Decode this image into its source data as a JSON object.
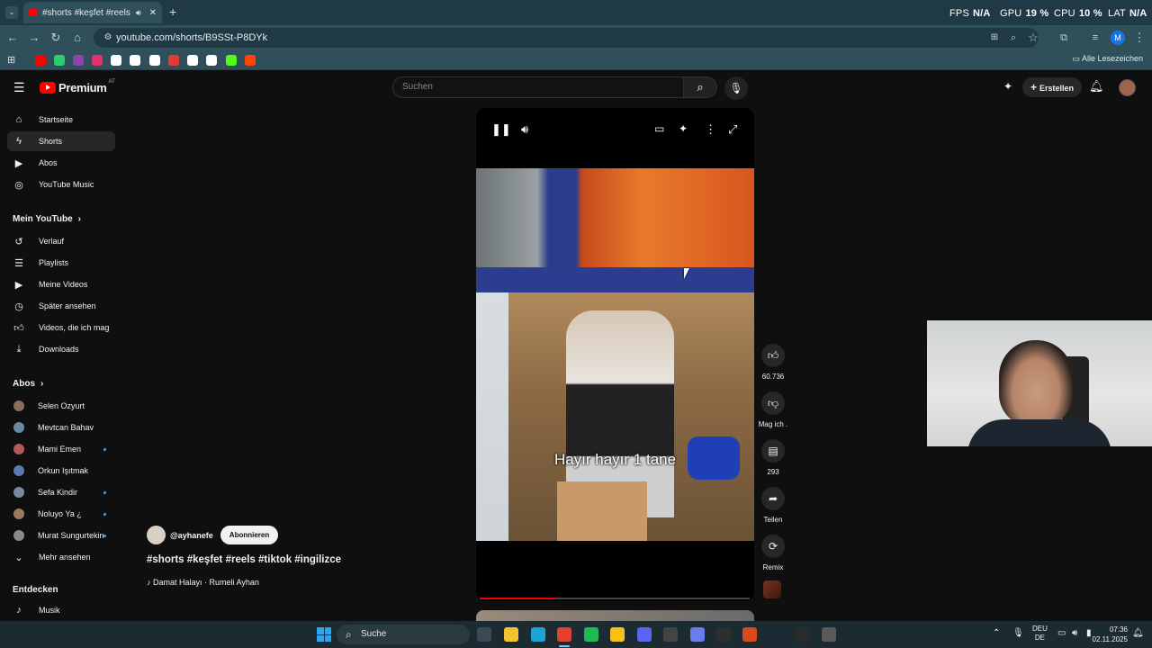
{
  "browser": {
    "tab_title": "#shorts #keşfet #reels #tiktok",
    "url": "youtube.com/shorts/B9SSt-P8DYk",
    "all_bookmarks": "Alle Lesezeichen",
    "stats": {
      "fps_label": "FPS",
      "fps_value": "N/A",
      "gpu_label": "GPU",
      "gpu_value": "19 %",
      "cpu_label": "CPU",
      "cpu_value": "10 %",
      "lat_label": "LAT",
      "lat_value": "N/A"
    },
    "bookmark_colors": [
      "#ff0000",
      "#2ecc71",
      "#8e44ad",
      "#e1306c",
      "#ffffff",
      "#ffffff",
      "#ffffff",
      "#e53935",
      "#ffffff",
      "#ffffff",
      "#53fc18",
      "#ff4500"
    ]
  },
  "youtube": {
    "logo": "Premium",
    "logo_badge": "AT",
    "search_placeholder": "Suchen",
    "create_label": "Erstellen",
    "nav": [
      {
        "label": "Startseite",
        "icon": "home-icon"
      },
      {
        "label": "Shorts",
        "icon": "shorts-icon"
      },
      {
        "label": "Abos",
        "icon": "subscriptions-icon"
      },
      {
        "label": "YouTube Music",
        "icon": "music-icon"
      }
    ],
    "my_section": "Mein YouTube",
    "my_items": [
      {
        "label": "Verlauf"
      },
      {
        "label": "Playlists"
      },
      {
        "label": "Meine Videos"
      },
      {
        "label": "Später ansehen"
      },
      {
        "label": "Videos, die ich mag"
      },
      {
        "label": "Downloads"
      }
    ],
    "subs_section": "Abos",
    "subs": [
      {
        "name": "Selen Ozyurt",
        "color": "#8a6d5a",
        "new": false
      },
      {
        "name": "Mevtcan Bahav",
        "color": "#6a8aa0",
        "new": false
      },
      {
        "name": "Mami Emen",
        "color": "#b05a5a",
        "new": true
      },
      {
        "name": "Orkun Işıtmak",
        "color": "#5a7ab0",
        "new": false
      },
      {
        "name": "Sefa Kindir",
        "color": "#7a8aa0",
        "new": true
      },
      {
        "name": "Noluyo Ya ¿",
        "color": "#9a7a5a",
        "new": true
      },
      {
        "name": "Murat Sungurtekin",
        "color": "#8a8a8a",
        "new": true
      }
    ],
    "more_label": "Mehr ansehen",
    "explore_section": "Entdecken",
    "explore_items": [
      {
        "label": "Musik"
      }
    ],
    "short": {
      "channel": "@ayhanefe",
      "subscribe_label": "Abonnieren",
      "title": "#shorts #keşfet #reels #tiktok #ingilizce",
      "sound": "Damat Halayı · Rumeli Ayhan",
      "caption": "Hayır hayır 1 tane",
      "progress": 0.28
    },
    "actions": {
      "like_count": "60.736",
      "dislike_label": "Mag ich .",
      "comment_count": "293",
      "share_label": "Teilen",
      "remix_label": "Remix"
    }
  },
  "taskbar": {
    "search_label": "Suche",
    "lang": "DEU",
    "lang_sub": "DE",
    "time": "07:36",
    "date": "02.11.2025"
  }
}
